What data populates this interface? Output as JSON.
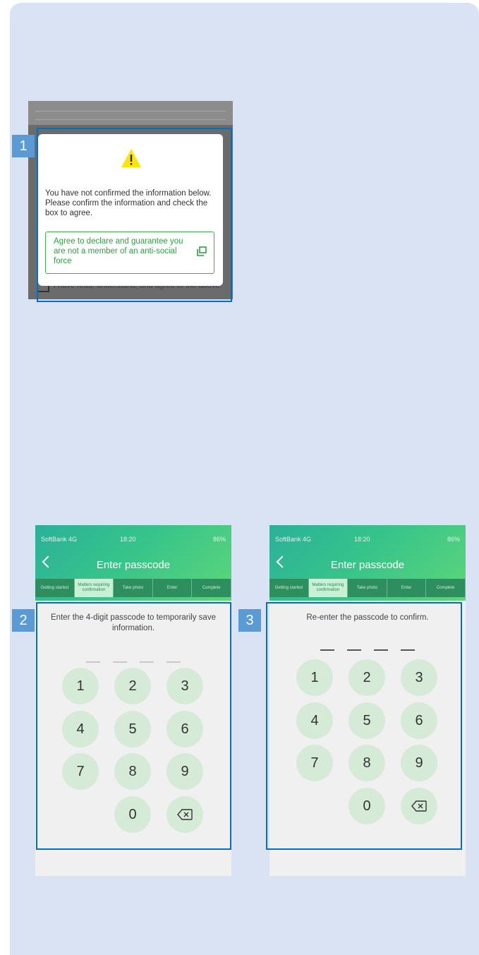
{
  "badges": {
    "one": "1",
    "two": "2",
    "three": "3"
  },
  "dialog": {
    "message": "You have not confirmed the information below. Please confirm the information and check the box to agree.",
    "agree_text": "Agree to declare and guarantee you are not a member of an anti-social force",
    "behind_text": "I have read, understand, and agree to the above.",
    "icons": {
      "warning": "warning-triangle-icon",
      "external": "open-in-new-icon"
    }
  },
  "phone": {
    "carrier": "SoftBank 4G",
    "time": "18:20",
    "battery": "86%",
    "title": "Enter passcode",
    "steps": [
      "Getting started",
      "Matters requiring confirmation",
      "Take photo",
      "Enter",
      "Complete"
    ],
    "active_step": 1
  },
  "screen2": {
    "prompt": "Enter the 4-digit passcode to temporarily save information."
  },
  "screen3": {
    "prompt": "Re-enter the passcode to confirm."
  },
  "keypad": {
    "keys": [
      "1",
      "2",
      "3",
      "4",
      "5",
      "6",
      "7",
      "8",
      "9",
      "0"
    ],
    "delete_icon": "backspace-icon"
  },
  "colors": {
    "accent_green": "#37b34a",
    "frame_blue": "#0070c0",
    "badge_blue": "#5b9bd5",
    "card_bg": "#dae3f3"
  }
}
